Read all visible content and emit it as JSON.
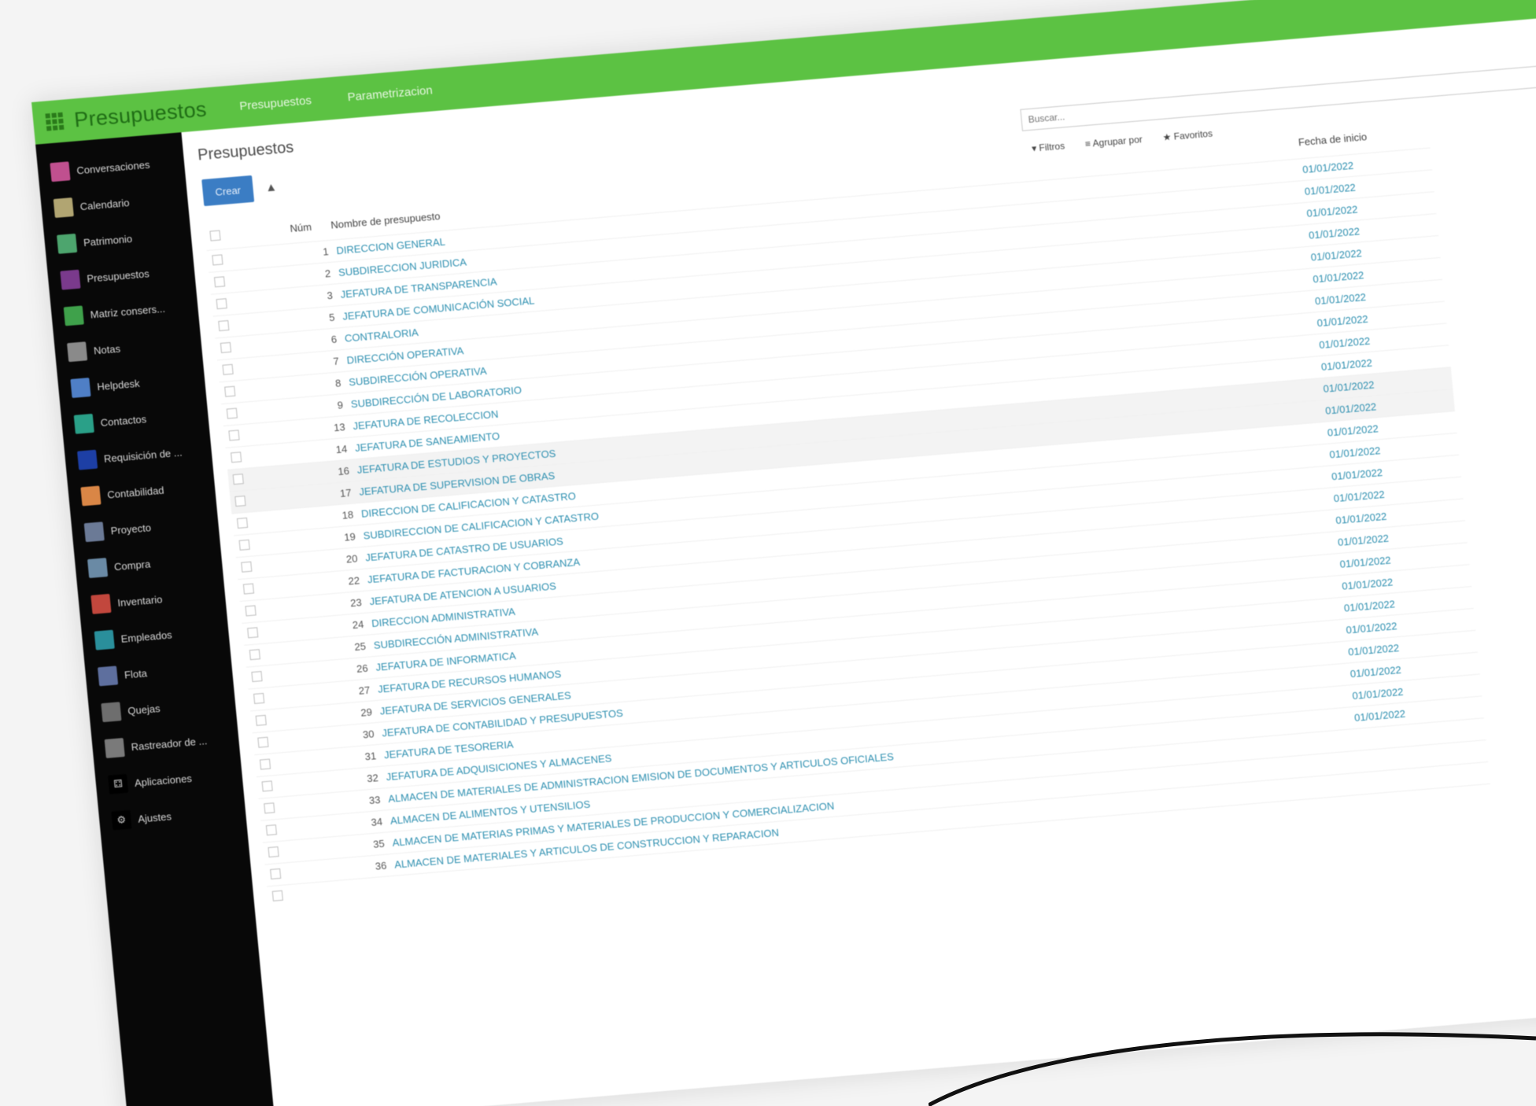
{
  "app": {
    "title": "Presupuestos",
    "menus": [
      "Presupuestos",
      "Parametrizacion"
    ]
  },
  "sidebar": {
    "items": [
      {
        "label": "Conversaciones",
        "icon": "chat-icon",
        "color": "#c0508f"
      },
      {
        "label": "Calendario",
        "icon": "calendar-icon",
        "color": "#b1a572"
      },
      {
        "label": "Patrimonio",
        "icon": "asset-icon",
        "color": "#4da56e"
      },
      {
        "label": "Presupuestos",
        "icon": "budget-icon",
        "color": "#7a3a8c"
      },
      {
        "label": "Matriz consers...",
        "icon": "matrix-icon",
        "color": "#3fa14b"
      },
      {
        "label": "Notas",
        "icon": "notes-icon",
        "color": "#8a8a8a"
      },
      {
        "label": "Helpdesk",
        "icon": "helpdesk-icon",
        "color": "#4f7fc6"
      },
      {
        "label": "Contactos",
        "icon": "contacts-icon",
        "color": "#2aa088"
      },
      {
        "label": "Requisición de ...",
        "icon": "requisition-icon",
        "color": "#1d3fa5"
      },
      {
        "label": "Contabilidad",
        "icon": "accounting-icon",
        "color": "#d98646"
      },
      {
        "label": "Proyecto",
        "icon": "project-icon",
        "color": "#6b7a96"
      },
      {
        "label": "Compra",
        "icon": "purchase-icon",
        "color": "#6a8aa5"
      },
      {
        "label": "Inventario",
        "icon": "inventory-icon",
        "color": "#c2473d"
      },
      {
        "label": "Empleados",
        "icon": "employees-icon",
        "color": "#2a8f9b"
      },
      {
        "label": "Flota",
        "icon": "fleet-icon",
        "color": "#5e6f9e"
      },
      {
        "label": "Quejas",
        "icon": "complaints-icon",
        "color": "#6e6e6e"
      },
      {
        "label": "Rastreador de ...",
        "icon": "tracker-icon",
        "color": "#7a7a7a"
      },
      {
        "label": "Aplicaciones",
        "icon": "apps-icon",
        "color": "#000000"
      },
      {
        "label": "Ajustes",
        "icon": "settings-icon",
        "color": "#000000"
      }
    ]
  },
  "main": {
    "title": "Presupuestos",
    "create_label": "Crear",
    "download_glyph": "▲",
    "search_placeholder": "Buscar...",
    "filters": [
      "▾ Filtros",
      "≡ Agrupar por",
      "★ Favoritos"
    ],
    "columns": {
      "num": "Núm",
      "name": "Nombre de presupuesto",
      "date": "Fecha de inicio"
    }
  },
  "rows": [
    {
      "num": "1",
      "name": "DIRECCION GENERAL",
      "date": "01/01/2022"
    },
    {
      "num": "2",
      "name": "SUBDIRECCION JURIDICA",
      "date": "01/01/2022"
    },
    {
      "num": "3",
      "name": "JEFATURA DE TRANSPARENCIA",
      "date": "01/01/2022"
    },
    {
      "num": "5",
      "name": "JEFATURA DE COMUNICACIÓN SOCIAL",
      "date": "01/01/2022"
    },
    {
      "num": "6",
      "name": "CONTRALORIA",
      "date": "01/01/2022"
    },
    {
      "num": "7",
      "name": "DIRECCIÓN OPERATIVA",
      "date": "01/01/2022"
    },
    {
      "num": "8",
      "name": "SUBDIRECCIÓN OPERATIVA",
      "date": "01/01/2022"
    },
    {
      "num": "9",
      "name": "SUBDIRECCIÓN DE LABORATORIO",
      "date": "01/01/2022"
    },
    {
      "num": "13",
      "name": "JEFATURA DE RECOLECCION",
      "date": "01/01/2022"
    },
    {
      "num": "14",
      "name": "JEFATURA DE SANEAMIENTO",
      "date": "01/01/2022"
    },
    {
      "num": "16",
      "name": "JEFATURA DE ESTUDIOS Y PROYECTOS",
      "date": "01/01/2022"
    },
    {
      "num": "17",
      "name": "JEFATURA DE SUPERVISION DE OBRAS",
      "date": "01/01/2022"
    },
    {
      "num": "18",
      "name": "DIRECCION DE CALIFICACION Y CATASTRO",
      "date": "01/01/2022"
    },
    {
      "num": "19",
      "name": "SUBDIRECCION DE CALIFICACION Y CATASTRO",
      "date": "01/01/2022"
    },
    {
      "num": "20",
      "name": "JEFATURA DE CATASTRO DE USUARIOS",
      "date": "01/01/2022"
    },
    {
      "num": "22",
      "name": "JEFATURA DE FACTURACION Y COBRANZA",
      "date": "01/01/2022"
    },
    {
      "num": "23",
      "name": "JEFATURA DE ATENCION A USUARIOS",
      "date": "01/01/2022"
    },
    {
      "num": "24",
      "name": "DIRECCION ADMINISTRATIVA",
      "date": "01/01/2022"
    },
    {
      "num": "25",
      "name": "SUBDIRECCIÓN ADMINISTRATIVA",
      "date": "01/01/2022"
    },
    {
      "num": "26",
      "name": "JEFATURA DE INFORMATICA",
      "date": "01/01/2022"
    },
    {
      "num": "27",
      "name": "JEFATURA DE RECURSOS HUMANOS",
      "date": "01/01/2022"
    },
    {
      "num": "29",
      "name": "JEFATURA DE SERVICIOS GENERALES",
      "date": "01/01/2022"
    },
    {
      "num": "30",
      "name": "JEFATURA DE CONTABILIDAD Y PRESUPUESTOS",
      "date": "01/01/2022"
    },
    {
      "num": "31",
      "name": "JEFATURA DE TESORERIA",
      "date": "01/01/2022"
    },
    {
      "num": "32",
      "name": "JEFATURA DE ADQUISICIONES Y ALMACENES",
      "date": "01/01/2022"
    },
    {
      "num": "33",
      "name": "ALMACEN DE MATERIALES DE ADMINISTRACION EMISION DE DOCUMENTOS Y ARTICULOS OFICIALES",
      "date": "01/01/2022"
    },
    {
      "num": "34",
      "name": "ALMACEN DE ALIMENTOS Y UTENSILIOS",
      "date": ""
    },
    {
      "num": "35",
      "name": "ALMACEN DE MATERIAS PRIMAS Y MATERIALES DE PRODUCCION Y COMERCIALIZACION",
      "date": ""
    },
    {
      "num": "36",
      "name": "ALMACEN DE MATERIALES Y ARTICULOS DE CONSTRUCCION Y REPARACION",
      "date": ""
    },
    {
      "num": "",
      "name": "",
      "date": ""
    }
  ],
  "highlighted_rows": [
    10,
    11
  ]
}
